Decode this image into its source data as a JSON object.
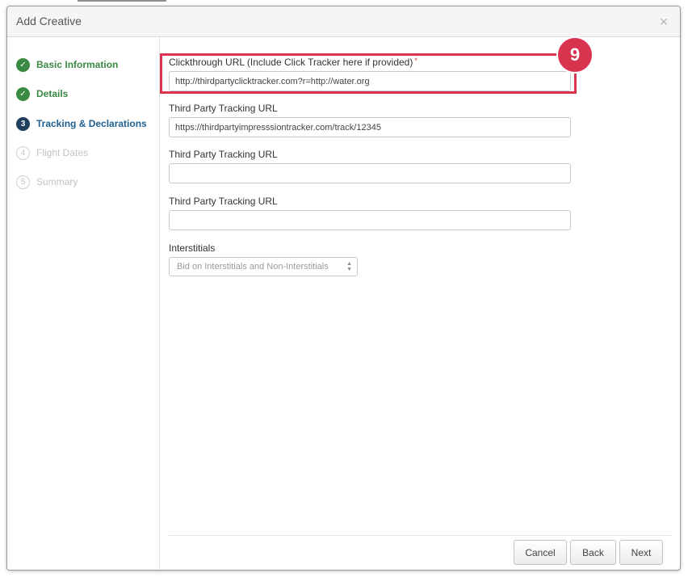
{
  "modal": {
    "title": "Add Creative",
    "close_glyph": "×"
  },
  "steps": [
    {
      "marker": "✓",
      "label": "Basic Information",
      "state": "done"
    },
    {
      "marker": "✓",
      "label": "Details",
      "state": "done"
    },
    {
      "marker": "3",
      "label": "Tracking & Declarations",
      "state": "active"
    },
    {
      "marker": "4",
      "label": "Flight Dates",
      "state": "todo"
    },
    {
      "marker": "5",
      "label": "Summary",
      "state": "todo"
    }
  ],
  "form": {
    "clickthrough": {
      "label": "Clickthrough URL (Include Click Tracker here if provided)",
      "required_mark": "*",
      "value": "http://thirdpartyclicktracker.com?r=http://water.org"
    },
    "tracking_fields": [
      {
        "label": "Third Party Tracking URL",
        "value": "https://thirdpartyimpresssiontracker.com/track/12345"
      },
      {
        "label": "Third Party Tracking URL",
        "value": ""
      },
      {
        "label": "Third Party Tracking URL",
        "value": ""
      }
    ],
    "interstitials": {
      "label": "Interstitials",
      "selected": "Bid on Interstitials and Non-Interstitials"
    }
  },
  "callout": {
    "number": "9",
    "color": "#d9344f"
  },
  "footer": {
    "cancel_label": "Cancel",
    "back_label": "Back",
    "next_label": "Next"
  }
}
